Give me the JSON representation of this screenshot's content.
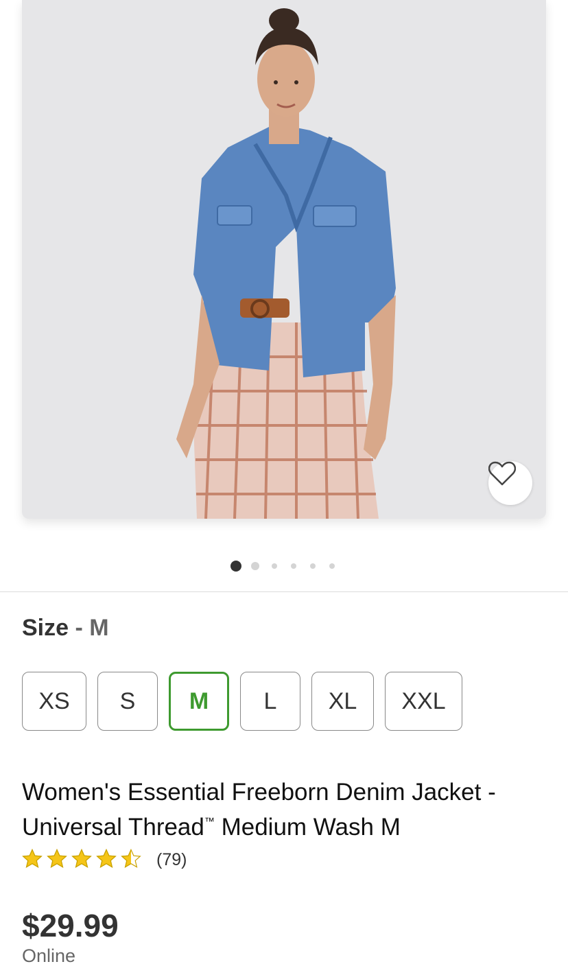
{
  "product_image": {
    "description": "Model wearing denim jacket over plaid dress"
  },
  "favorite_icon": "heart-outline-icon",
  "carousel": {
    "total": 6,
    "active": 1
  },
  "size": {
    "label": "Size",
    "separator": "-",
    "selected": "M",
    "options": [
      "XS",
      "S",
      "M",
      "L",
      "XL",
      "XXL"
    ]
  },
  "product": {
    "title_line1": "Women's Essential Freeborn Denim Jacket -",
    "title_line2a": "Universal Thread",
    "trademark": "™",
    "title_line2b": " Medium Wash M",
    "rating": 4.5,
    "rating_max": 5,
    "review_count": "(79)",
    "price": "$29.99",
    "availability": "Online"
  },
  "colors": {
    "accent_green": "#3e9a2f",
    "star": "#f5c518",
    "image_bg": "#e6e6e8"
  }
}
